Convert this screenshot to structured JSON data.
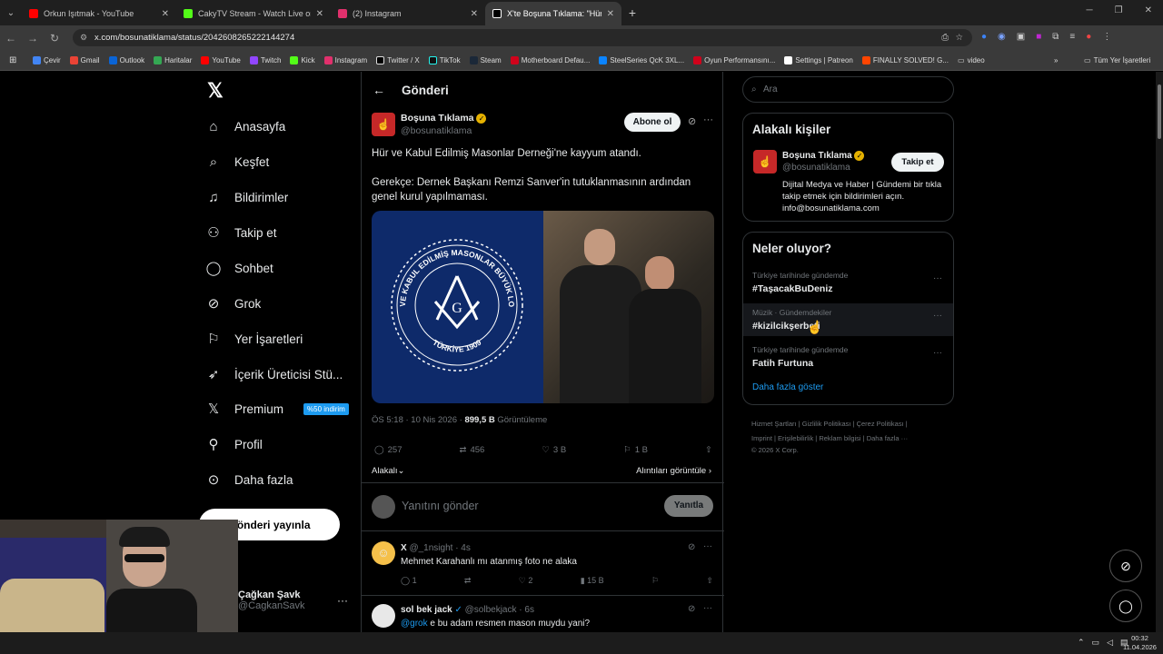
{
  "tabs": [
    {
      "title": "Orkun Işıtmak - YouTube",
      "color": "#ff0000"
    },
    {
      "title": "CakyTV Stream - Watch Live on",
      "color": "#53fc18"
    },
    {
      "title": "(2) Instagram",
      "color": "#e1306c"
    },
    {
      "title": "X'te Boşuna Tıklama: \"Hür ve K...",
      "color": "#ffffff"
    }
  ],
  "address": {
    "url": "x.com/bosunatiklama/status/2042608265222144274"
  },
  "bookmarks": [
    "Çevir",
    "Gmail",
    "Outlook",
    "Haritalar",
    "YouTube",
    "Twitch",
    "Kick",
    "Instagram",
    "Twitter / X",
    "TikTok",
    "Steam",
    "Motherboard Defau...",
    "SteelSeries QcK 3XL...",
    "Oyun Performansını...",
    "Settings | Patreon",
    "FINALLY SOLVED! G...",
    "video",
    "Tüm Yer İşaretleri"
  ],
  "nav": {
    "items": [
      "Anasayfa",
      "Keşfet",
      "Bildirimler",
      "Takip et",
      "Sohbet",
      "Grok",
      "Yer İşaretleri",
      "İçerik Üreticisi Stü...",
      "Premium",
      "Profil",
      "Daha fazla"
    ],
    "premium_badge": "%50 indirim",
    "post_button": "Gönderi yayınla",
    "user_name": "Çağkan Şavk",
    "user_handle": "@CagkanSavk"
  },
  "header": {
    "title": "Gönderi"
  },
  "post": {
    "author": "Boşuna Tıklama",
    "handle": "@bosunatiklama",
    "follow_label": "Abone ol",
    "text1": "Hür ve Kabul Edilmiş Masonlar Derneği'ne kayyum atandı.",
    "text2": "Gerekçe: Dernek Başkanı Remzi Sanver'in tutuklanmasının ardından genel kurul yapılmaması.",
    "seal_top": "HÜR VE KABUL EDİLMİŞ MASONLAR BÜYÜK LOCASI",
    "seal_bottom": "TÜRKİYE 1909",
    "time": "ÖS 5:18 · 10 Nis 2026 ·",
    "views_count": "899,5 B",
    "views_label": "Görüntüleme",
    "replies": "257",
    "reposts": "456",
    "likes": "3 B",
    "bookmarks": "1 B",
    "relevant": "Alakalı",
    "quotes": "Alıntıları görüntüle"
  },
  "reply_box": {
    "placeholder": "Yanıtını gönder",
    "button": "Yanıtla"
  },
  "replies": [
    {
      "name": "X",
      "handle": "@_1nsight · 4s",
      "text": "Mehmet Karahanlı mı atanmış foto ne alaka",
      "replies": "1",
      "likes": "2",
      "views": "15 B"
    },
    {
      "name": "sol bek jack",
      "handle": "@solbekjack · 6s",
      "mention": "@grok",
      "text": " e bu adam resmen mason muydu yani?"
    }
  ],
  "search": {
    "placeholder": "Ara"
  },
  "related": {
    "title": "Alakalı kişiler",
    "name": "Boşuna Tıklama",
    "handle": "@bosunatiklama",
    "follow": "Takip et",
    "bio": "Dijital Medya ve Haber | Gündemi bir tıkla takip etmek için bildirimleri açın. info@bosunatiklama.com"
  },
  "trends": {
    "title": "Neler oluyor?",
    "items": [
      {
        "meta": "Türkiye tarihinde gündemde",
        "name": "#TaşacakBuDeniz"
      },
      {
        "meta": "Müzik · Gündemdekiler",
        "name": "#kizilcikşerbeti"
      },
      {
        "meta": "Türkiye tarihinde gündemde",
        "name": "Fatih Furtuna"
      }
    ],
    "more": "Daha fazla göster"
  },
  "footer": {
    "line1": "Hizmet Şartları | Gizlilik Politikası | Çerez Politikası |",
    "line2": "Imprint | Erişilebilirlik | Reklam bilgisi | Daha fazla ···",
    "line3": "© 2026 X Corp."
  },
  "taskbar": {
    "time": "00:32",
    "date": "11.04.2026"
  }
}
